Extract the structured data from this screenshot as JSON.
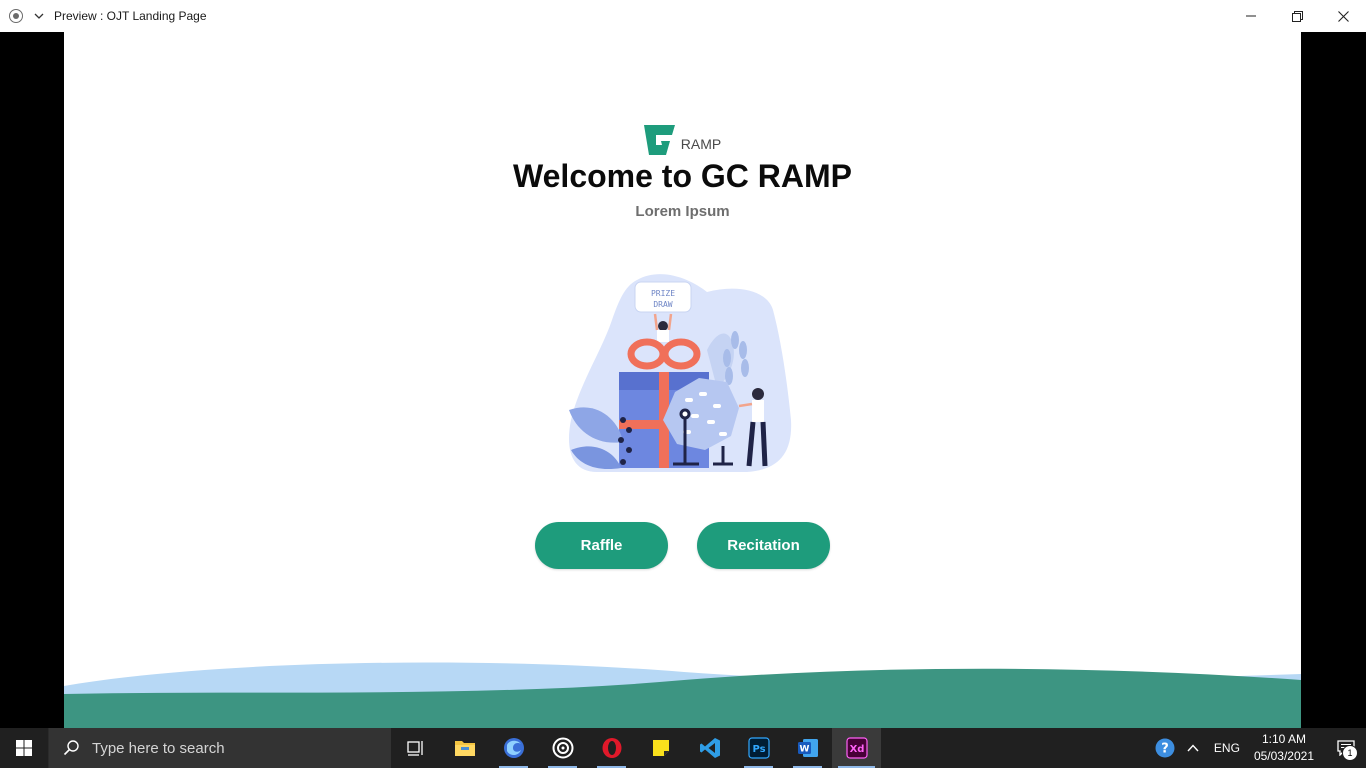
{
  "window": {
    "title": "Preview : OJT Landing Page",
    "controls": [
      "minimize",
      "restore",
      "close"
    ]
  },
  "page": {
    "logo_text": "RAMP",
    "headline": "Welcome to GC RAMP",
    "subline": "Lorem Ipsum",
    "hero_badge_line1": "PRIZE",
    "hero_badge_line2": "DRAW",
    "buttons": {
      "raffle": "Raffle",
      "recitation": "Recitation"
    },
    "colors": {
      "accent": "#1e9c7c",
      "wave_front": "#3d9582",
      "wave_back": "#b7d8f5"
    }
  },
  "taskbar": {
    "search_placeholder": "Type here to search",
    "apps": [
      "task-view",
      "file-explorer",
      "firefox",
      "obs",
      "opera",
      "sticky-notes",
      "vscode",
      "photoshop",
      "word",
      "adobe-xd"
    ],
    "photoshop_label": "Ps",
    "xd_label": "Xd",
    "word_label": "W",
    "language": "ENG",
    "time": "1:10 AM",
    "date": "05/03/2021",
    "notifications": "1"
  }
}
